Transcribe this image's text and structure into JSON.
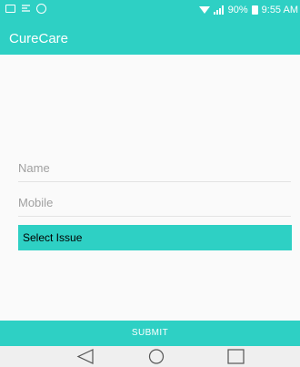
{
  "status_bar": {
    "icons": [
      "image-icon",
      "mail-icon",
      "check-circle-icon",
      "wifi-icon",
      "signal-icon",
      "battery-icon"
    ],
    "battery": "90%",
    "time": "9:55 AM"
  },
  "app_bar": {
    "title": "CureCare"
  },
  "form": {
    "name_placeholder": "Name",
    "mobile_placeholder": "Mobile",
    "issue_label": "Select Issue"
  },
  "submit_label": "SUBMIT",
  "nav": {
    "icons": [
      "back-icon",
      "home-icon",
      "recent-apps-icon"
    ]
  },
  "colors": {
    "accent": "#2ed0c4",
    "background": "#fafafa",
    "navbar": "#efefef"
  }
}
